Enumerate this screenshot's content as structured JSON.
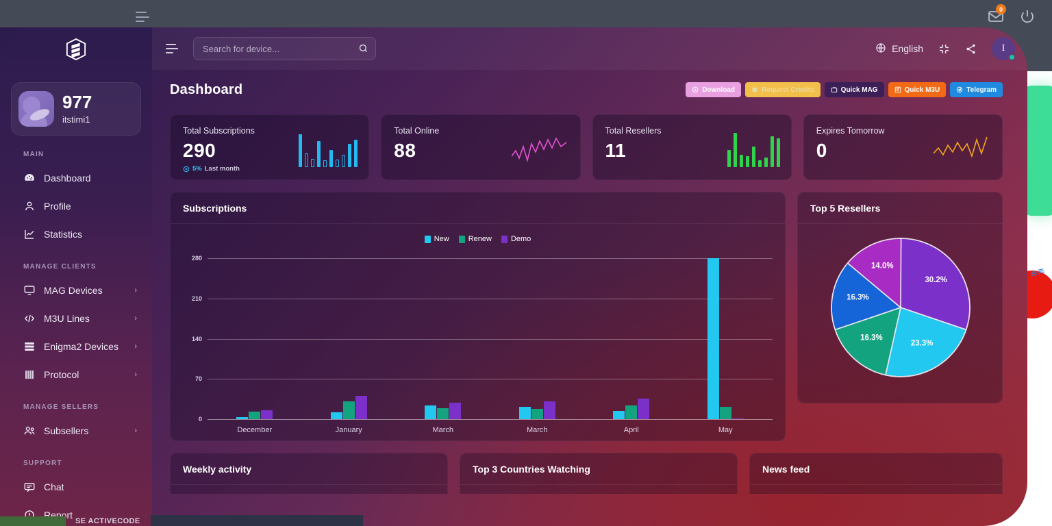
{
  "chrome": {
    "mail_badge": "0",
    "icons": [
      "hamburger-icon",
      "mail-icon",
      "power-icon"
    ]
  },
  "sidebar": {
    "brand": "logo-icon",
    "user": {
      "credits": "977",
      "username": "itstimi1"
    },
    "sections": [
      {
        "title": "MAIN",
        "items": [
          {
            "label": "Dashboard",
            "icon": "dashboard-icon",
            "caret": ""
          },
          {
            "label": "Profile",
            "icon": "user-icon",
            "caret": ""
          },
          {
            "label": "Statistics",
            "icon": "chart-line-icon",
            "caret": ""
          }
        ]
      },
      {
        "title": "MANAGE CLIENTS",
        "items": [
          {
            "label": "MAG Devices",
            "icon": "monitor-icon",
            "caret": "›"
          },
          {
            "label": "M3U Lines",
            "icon": "code-icon",
            "caret": "›"
          },
          {
            "label": "Enigma2 Devices",
            "icon": "server-icon",
            "caret": "›"
          },
          {
            "label": "Protocol",
            "icon": "book-icon",
            "caret": "›"
          }
        ]
      },
      {
        "title": "MANAGE SELLERS",
        "items": [
          {
            "label": "Subsellers",
            "icon": "users-icon",
            "caret": "›"
          }
        ]
      },
      {
        "title": "SUPPORT",
        "items": [
          {
            "label": "Chat",
            "icon": "chat-icon",
            "caret": ""
          },
          {
            "label": "Report",
            "icon": "report-icon",
            "caret": ""
          }
        ]
      }
    ]
  },
  "topbar": {
    "search_placeholder": "Search for device...",
    "search_value": "",
    "language": "English",
    "avatar_initial": "I"
  },
  "page": {
    "title": "Dashboard",
    "actions": [
      {
        "label": "Download",
        "icon": "download-icon",
        "bg": "#e8a0e0",
        "color": "#ffffff"
      },
      {
        "label": "Request Credits",
        "icon": "credits-icon",
        "bg": "#f2c04a",
        "color": "#e8d9a6"
      },
      {
        "label": "Quick MAG",
        "icon": "tv-icon",
        "bg": "#3b1f56",
        "color": "#ffffff"
      },
      {
        "label": "Quick M3U",
        "icon": "list-icon",
        "bg": "#f26a15",
        "color": "#ffffff"
      },
      {
        "label": "Telegram",
        "icon": "telegram-icon",
        "bg": "#1f8ae0",
        "color": "#ffffff"
      }
    ]
  },
  "stats": [
    {
      "label": "Total Subscriptions",
      "value": "290",
      "delta": "5%",
      "delta_suffix": "Last month",
      "delta_color": "#38bdf8",
      "spark_color": "#25b9f0",
      "spark": [
        92,
        38,
        24,
        74,
        20,
        48,
        22,
        34,
        66,
        76
      ],
      "spark_style": [
        "solid",
        "outline",
        "outline",
        "solid",
        "outline",
        "solid",
        "outline",
        "outline",
        "solid",
        "solid"
      ]
    },
    {
      "label": "Total Online",
      "value": "88",
      "delta": "",
      "delta_suffix": "",
      "delta_color": "#e254d0",
      "spark_color": "#e254d0",
      "spark": [],
      "spark_style": []
    },
    {
      "label": "Total Resellers",
      "value": "11",
      "delta": "",
      "delta_suffix": "",
      "delta_color": "#2fd44b",
      "spark_color": "#2fd44b",
      "spark": [
        48,
        96,
        34,
        30,
        58,
        20,
        26,
        86,
        80
      ],
      "spark_style": [
        "solid",
        "solid",
        "solid",
        "solid",
        "solid",
        "solid",
        "solid",
        "solid",
        "solid"
      ]
    },
    {
      "label": "Expires Tomorrow",
      "value": "0",
      "delta": "",
      "delta_suffix": "",
      "delta_color": "#f2a81d",
      "spark_color": "#f2a81d",
      "spark": [],
      "spark_style": []
    }
  ],
  "subscriptions_card": {
    "title": "Subscriptions"
  },
  "resellers_card": {
    "title": "Top 5 Resellers"
  },
  "bottom_cards": [
    {
      "title": "Weekly activity"
    },
    {
      "title": "Top 3 Countries Watching"
    },
    {
      "title": "News feed"
    }
  ],
  "footer": {
    "activecode": "SE ACTIVECODE"
  },
  "chart_data": [
    {
      "type": "bar",
      "title": "Subscriptions",
      "categories": [
        "December",
        "January",
        "March",
        "March",
        "April",
        "May"
      ],
      "series": [
        {
          "name": "New",
          "color": "#22c8f0",
          "values": [
            4,
            12,
            24,
            22,
            14,
            280
          ]
        },
        {
          "name": "Renew",
          "color": "#13a37e",
          "values": [
            13,
            31,
            19,
            18,
            24,
            22
          ]
        },
        {
          "name": "Demo",
          "color": "#7b30c9",
          "values": [
            15,
            41,
            29,
            31,
            36,
            1
          ]
        }
      ],
      "xlabel": "",
      "ylabel": "",
      "ylim": [
        0,
        280
      ],
      "yticks": [
        0,
        70,
        140,
        210,
        280
      ],
      "grid": true,
      "legend_position": "top-center"
    },
    {
      "type": "pie",
      "title": "Top 5 Resellers",
      "labels": [
        "30.2%",
        "23.3%",
        "16.3%",
        "16.3%",
        "14.0%"
      ],
      "values": [
        30.2,
        23.3,
        16.3,
        16.3,
        14.0
      ],
      "colors": [
        "#7b30c9",
        "#22c8f0",
        "#13a37e",
        "#1565d8",
        "#a82bc4"
      ],
      "legend_position": "none"
    }
  ]
}
